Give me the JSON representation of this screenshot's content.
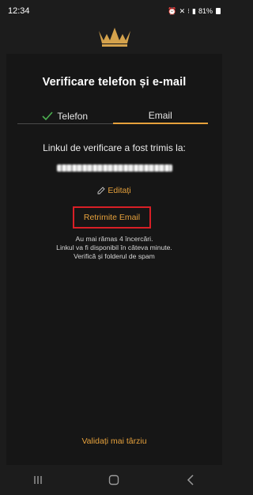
{
  "status_bar": {
    "time": "12:34",
    "icons": [
      "alarm-icon",
      "mute-icon",
      "5g-icon",
      "signal-icon"
    ],
    "battery": "81%"
  },
  "logo": {
    "name": "crown-logo",
    "color": "#d4a24c"
  },
  "page": {
    "title": "Verificare telefon și e-mail",
    "tabs": [
      {
        "label": "Telefon",
        "state": "done"
      },
      {
        "label": "Email",
        "state": "active"
      }
    ],
    "sent_label": "Linkul de verificare a fost trimis la:",
    "edit_label": "Editați",
    "resend_label": "Retrimite Email",
    "info": [
      "Au mai rămas 4 încercări.",
      "Linkul va fi disponibil în câteva minute.",
      "Verifică și folderul de spam"
    ],
    "later_label": "Validați mai târziu"
  },
  "colors": {
    "accent": "#e6a13c",
    "highlight_border": "#d81f26",
    "check": "#4caf50"
  },
  "nav_bar": {
    "buttons": [
      "recent-apps-icon",
      "home-icon",
      "back-icon"
    ]
  }
}
